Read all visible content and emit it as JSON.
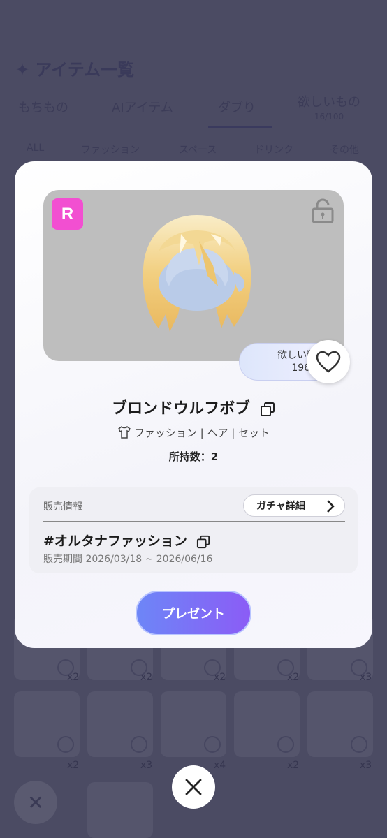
{
  "background": {
    "title": "✦ アイテム一覧",
    "tabs": [
      {
        "label": "もちもの"
      },
      {
        "label": "AIアイテム"
      },
      {
        "label": "ダブり"
      },
      {
        "label": "欲しいもの",
        "sub": "16/100"
      }
    ],
    "categories": [
      "ALL",
      "ファッション",
      "スペース",
      "ドリンク",
      "その他"
    ],
    "counts_row1": [
      "x2",
      "x2",
      "x2",
      "x2",
      "x3"
    ],
    "counts_row2": [
      "x2",
      "x3",
      "x4",
      "x2",
      "x3"
    ],
    "close_label": "✕"
  },
  "modal": {
    "rarity": "R",
    "wish_label": "欲しい数",
    "wish_count": "1966",
    "item_name": "ブロンドウルフボブ",
    "categories": "ファッション | ヘア | セット",
    "owned": "所持数：2",
    "sale": {
      "label": "販売情報",
      "gacha_button": "ガチャ詳細",
      "gacha_name": "#オルタナファッション",
      "period": "販売期間 2026/03/18 ~ 2026/06/16"
    },
    "present_button": "プレゼント"
  },
  "colors": {
    "rarity_badge": "#f24fd1",
    "present_start": "#6d86f7",
    "present_end": "#8b5cf6",
    "overlay": "#4b4b63"
  },
  "icons": [
    "unlock-icon",
    "heart-icon",
    "copy-icon",
    "shirt-icon",
    "chevron-right-icon",
    "close-icon"
  ]
}
